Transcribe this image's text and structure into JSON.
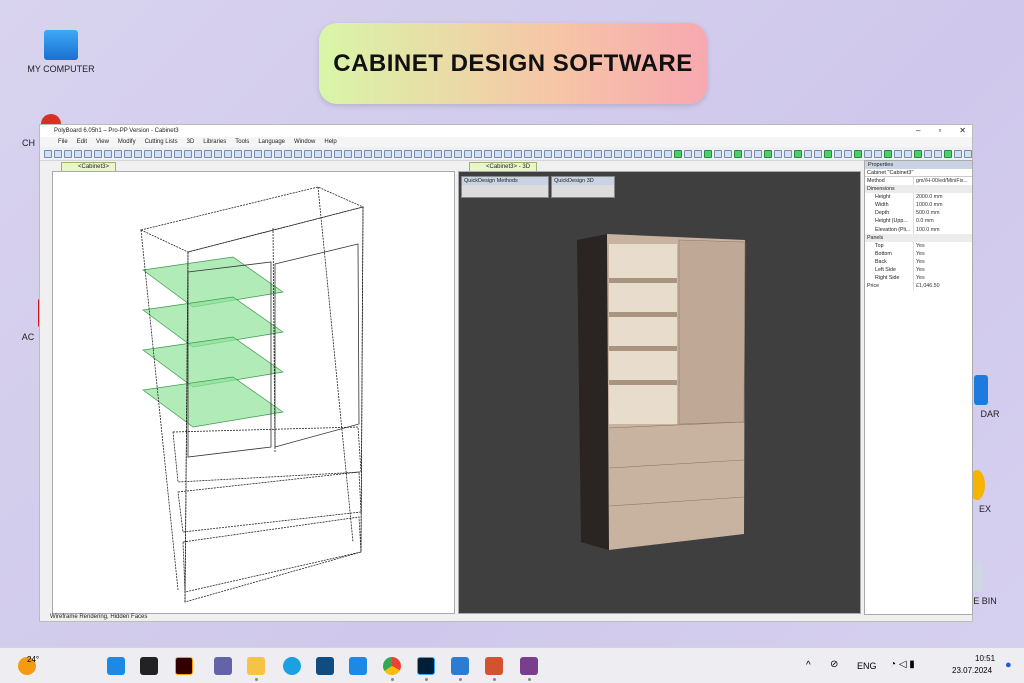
{
  "banner": {
    "title": "CABINET DESIGN SOFTWARE"
  },
  "desktop": {
    "icons": [
      "MY COMPUTER",
      "CH",
      "AC",
      "DAR",
      "EX",
      "E BIN"
    ]
  },
  "window": {
    "title": "PolyBoard 6.05h1 – Pro-PP Version - Cabinet3",
    "menu": [
      "File",
      "Edit",
      "View",
      "Modify",
      "Cutting Lists",
      "3D",
      "Libraries",
      "Tools",
      "Language",
      "Window",
      "Help"
    ],
    "left_tab": "<Cabinet3>",
    "right_tab": "<Cabinet3> - 3D",
    "qd_methods": "QuickDesign Methods",
    "qd_3d": "QuickDesign 3D",
    "status": "Wireframe Rendering, Hidden Faces"
  },
  "properties": {
    "title": "Properties",
    "object": "Cabinet \"Cabinet3\"",
    "rows": [
      {
        "k": "Method",
        "v": "gm//H-00/ed/MiniFix...",
        "type": "top"
      },
      {
        "k": "Dimensions",
        "type": "sec"
      },
      {
        "k": "Height",
        "v": "2000.0 mm"
      },
      {
        "k": "Width",
        "v": "1000.0 mm"
      },
      {
        "k": "Depth",
        "v": "500.0 mm"
      },
      {
        "k": "Height (Upp...",
        "v": "0.0 mm"
      },
      {
        "k": "Elevation (Pli...",
        "v": "100.0 mm"
      },
      {
        "k": "Panels",
        "type": "sec"
      },
      {
        "k": "Top",
        "v": "Yes"
      },
      {
        "k": "Bottom",
        "v": "Yes"
      },
      {
        "k": "Back",
        "v": "Yes"
      },
      {
        "k": "Left Side",
        "v": "Yes"
      },
      {
        "k": "Right Side",
        "v": "Yes"
      },
      {
        "k": "Price",
        "v": "£1,046.50",
        "type": "top"
      }
    ]
  },
  "taskbar": {
    "weather": "24°",
    "lang": "ENG",
    "time": "10:51",
    "date": "23.07.2024"
  },
  "colors": {
    "accent_green": "#7fd88a",
    "viewport_3d": "#3e3e3e",
    "wood": "#c9b4a0"
  }
}
